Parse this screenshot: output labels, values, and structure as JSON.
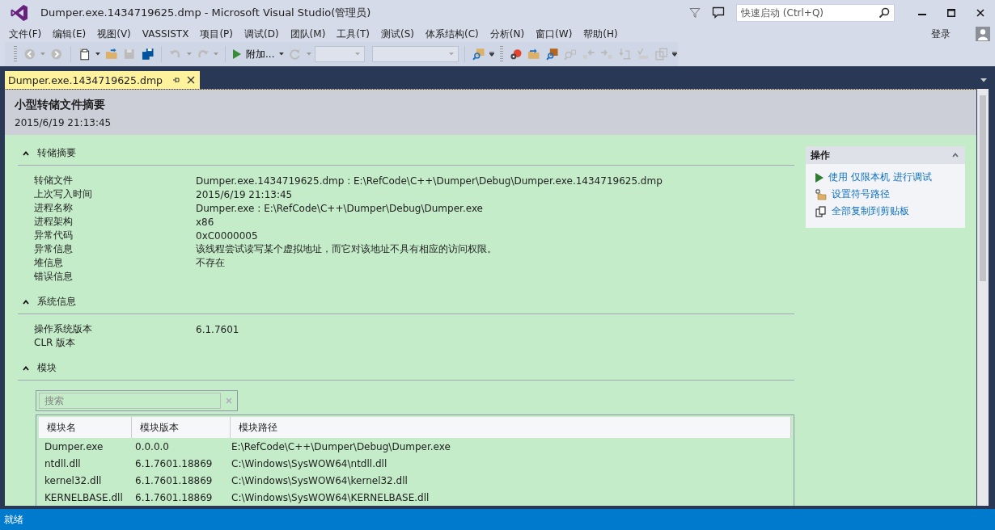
{
  "window": {
    "title": "Dumper.exe.1434719625.dmp - Microsoft Visual Studio(管理员)"
  },
  "quick_launch": {
    "placeholder": "快速启动 (Ctrl+Q)"
  },
  "menu": [
    "文件(F)",
    "编辑(E)",
    "视图(V)",
    "VASSISTX",
    "项目(P)",
    "调试(D)",
    "团队(M)",
    "工具(T)",
    "测试(S)",
    "体系结构(C)",
    "分析(N)",
    "窗口(W)",
    "帮助(H)"
  ],
  "sign_in": "登录",
  "toolbar": {
    "attach_label": "附加..."
  },
  "tabs": [
    {
      "label": "Dumper.exe.1434719625.dmp",
      "selected": true
    }
  ],
  "document": {
    "title": "小型转储文件摘要",
    "date": "2015/6/19 21:13:45",
    "sections": [
      {
        "title": "转储摘要",
        "expanded": true,
        "rows": [
          {
            "label": "转储文件",
            "value": "Dumper.exe.1434719625.dmp : E:\\RefCode\\C++\\Dumper\\Debug\\Dumper.exe.1434719625.dmp"
          },
          {
            "label": "上次写入时间",
            "value": "2015/6/19 21:13:45"
          },
          {
            "label": "进程名称",
            "value": "Dumper.exe : E:\\RefCode\\C++\\Dumper\\Debug\\Dumper.exe"
          },
          {
            "label": "进程架构",
            "value": "x86"
          },
          {
            "label": "异常代码",
            "value": "0xC0000005"
          },
          {
            "label": "异常信息",
            "value": "该线程尝试读写某个虚拟地址，而它对该地址不具有相应的访问权限。"
          },
          {
            "label": "堆信息",
            "value": "不存在"
          },
          {
            "label": "错误信息",
            "value": ""
          }
        ]
      },
      {
        "title": "系统信息",
        "expanded": true,
        "rows": [
          {
            "label": "操作系统版本",
            "value": "6.1.7601"
          },
          {
            "label": "CLR 版本",
            "value": ""
          }
        ]
      }
    ],
    "modules": {
      "title": "模块",
      "expanded": true,
      "search": {
        "placeholder": "搜索"
      },
      "columns": [
        "模块名",
        "模块版本",
        "模块路径"
      ],
      "rows": [
        [
          "Dumper.exe",
          "0.0.0.0",
          "E:\\RefCode\\C++\\Dumper\\Debug\\Dumper.exe"
        ],
        [
          "ntdll.dll",
          "6.1.7601.18869",
          "C:\\Windows\\SysWOW64\\ntdll.dll"
        ],
        [
          "kernel32.dll",
          "6.1.7601.18869",
          "C:\\Windows\\SysWOW64\\kernel32.dll"
        ],
        [
          "KERNELBASE.dll",
          "6.1.7601.18869",
          "C:\\Windows\\SysWOW64\\KERNELBASE.dll"
        ]
      ]
    },
    "actions": {
      "title": "操作",
      "expanded": true,
      "items": [
        {
          "kind": "debug",
          "label": "使用 仅限本机 进行调试"
        },
        {
          "kind": "symbols",
          "label": "设置符号路径"
        },
        {
          "kind": "copy",
          "label": "全部复制到剪贴板"
        }
      ]
    }
  },
  "status_bar": {
    "text": "就绪"
  }
}
